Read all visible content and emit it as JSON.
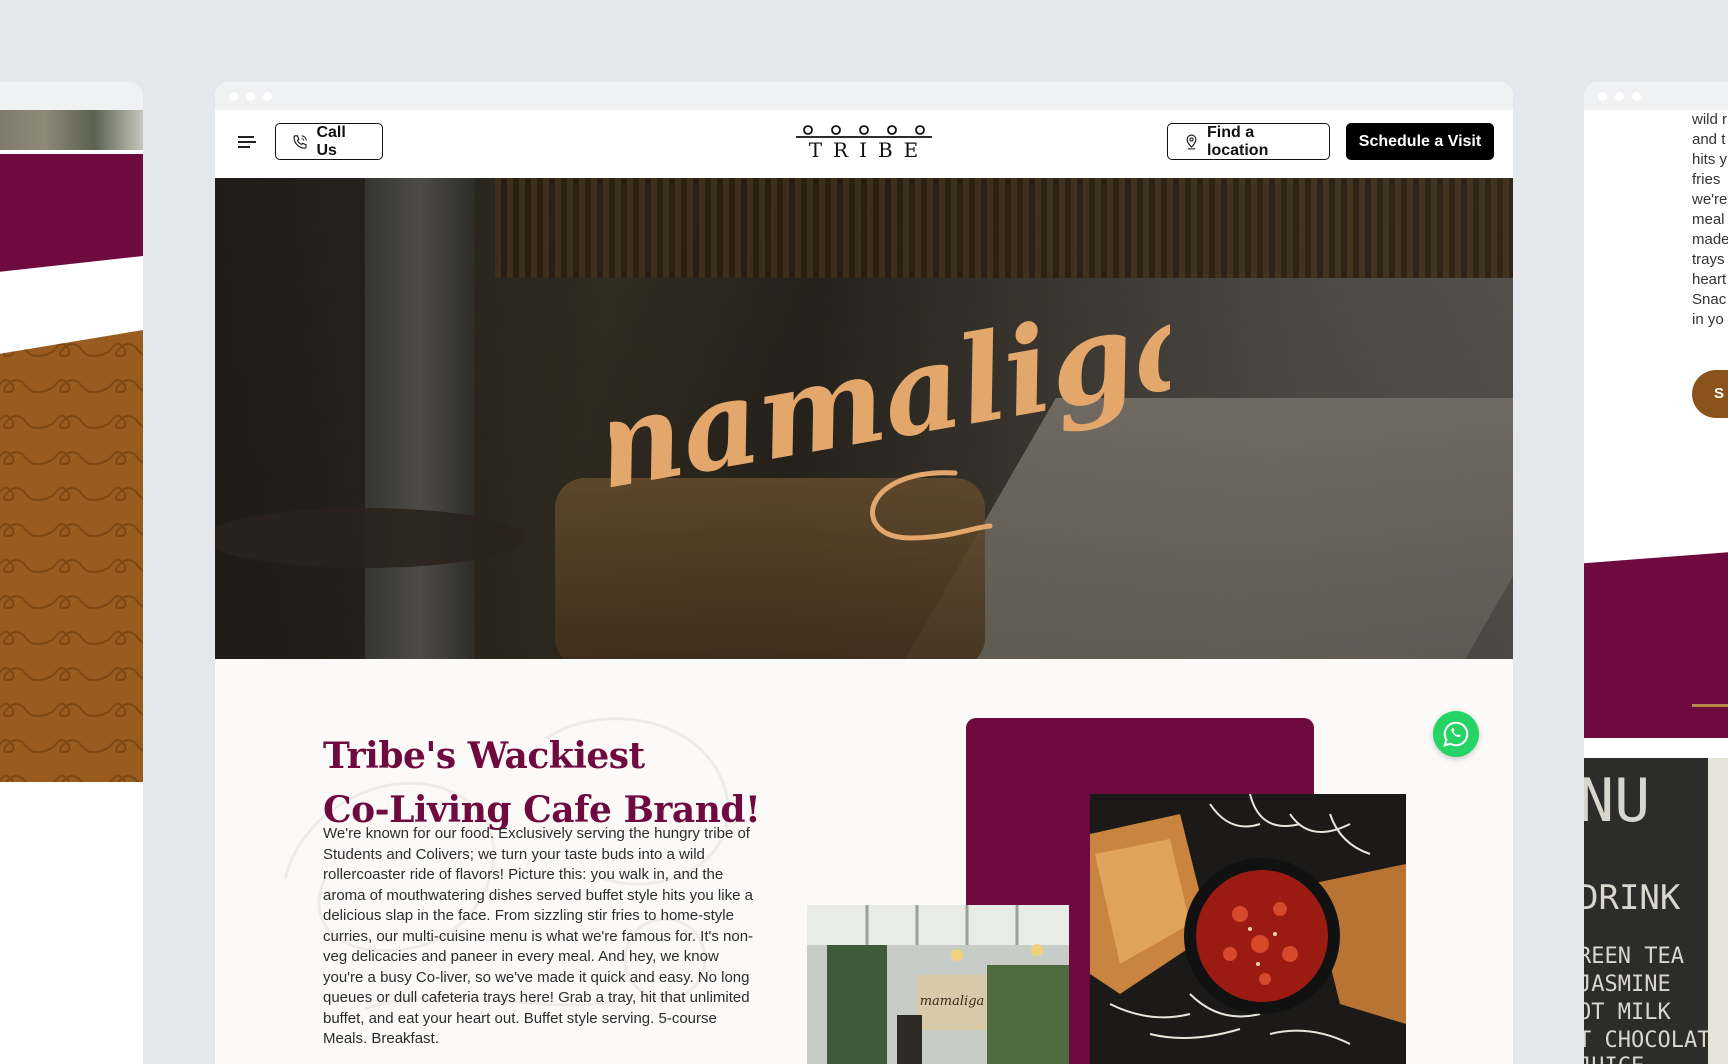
{
  "nav": {
    "call_label": "Call Us",
    "find_label": "Find a location",
    "visit_label": "Schedule a Visit",
    "logo_text": "TRIBE"
  },
  "hero": {
    "script_text": "mamaliga"
  },
  "intro": {
    "heading_line1": "Tribe's Wackiest",
    "heading_line2": "Co-Living Cafe Brand!",
    "body": "We're known for our food. Exclusively serving the hungry tribe of Students and Colivers; we turn your taste buds into a wild rollercoaster ride of flavors! Picture this: you walk in, and the aroma of mouthwatering dishes served buffet style hits you like a delicious slap in the face. From sizzling stir fries to home-style curries, our multi-cuisine menu is what we're famous for. It's non-veg delicacies and paneer in every meal. And hey, we know you're a busy Co-liver, so we've made it quick and easy. No long queues or dull cafeteria trays here! Grab a tray, hit that unlimited buffet, and eat your heart out. Buffet style serving. 5-course Meals. Breakfast."
  },
  "cafe_sign": "mamaliga",
  "right_panel": {
    "text_lines": "wild r\nand t\nhits y\nfries\nwe're\nmeal\nmade\ntrays\nheart\nSnac\nin yo",
    "button_fragment": "S",
    "chalk_lines": [
      "NU",
      "DRINK",
      "REEN TEA",
      "JASMINE",
      "OT MILK",
      "T CHOCOLATE",
      "JUICE"
    ]
  },
  "colors": {
    "maroon": "#6e0a3d",
    "gold": "#9a5c1e",
    "whatsapp": "#25d366",
    "hero_script": "#e3a66b"
  },
  "icons": [
    "menu-icon",
    "phone-icon",
    "location-pin-icon",
    "whatsapp-icon"
  ]
}
